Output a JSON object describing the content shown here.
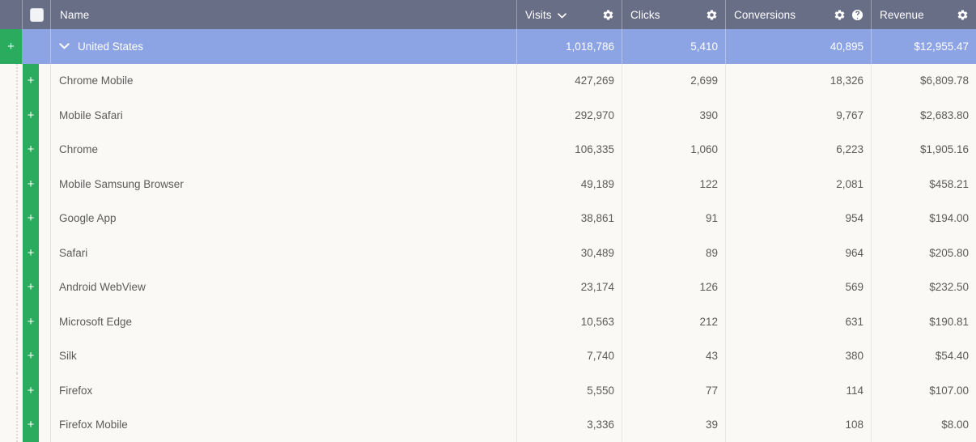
{
  "colors": {
    "header_bg": "#676e86",
    "selected_row_bg": "#8ca3e4",
    "row_bg": "#faf9f5",
    "expander_green": "#2bab5d",
    "text": "#5b5b5b",
    "header_text": "#ffffff"
  },
  "header": {
    "select_all_checkbox": "unchecked",
    "columns": [
      {
        "label": "Name",
        "key": "name",
        "sorted": false,
        "has_gear": false,
        "has_help": false,
        "align": "left"
      },
      {
        "label": "Visits",
        "key": "visits",
        "sorted": true,
        "has_gear": true,
        "has_help": false,
        "align": "right"
      },
      {
        "label": "Clicks",
        "key": "clicks",
        "sorted": false,
        "has_gear": true,
        "has_help": false,
        "align": "right"
      },
      {
        "label": "Conversions",
        "key": "conversions",
        "sorted": false,
        "has_gear": true,
        "has_help": true,
        "align": "right"
      },
      {
        "label": "Revenue",
        "key": "revenue",
        "sorted": false,
        "has_gear": true,
        "has_help": false,
        "align": "right"
      }
    ],
    "icons": {
      "sort_chevron": "chevron-down-icon",
      "gear": "gear-icon",
      "help": "help-circle-icon"
    }
  },
  "rows": [
    {
      "name": "United States",
      "visits": "1,018,786",
      "clicks": "5,410",
      "conversions": "40,895",
      "revenue": "$12,955.47",
      "level": 0,
      "selected": true,
      "expanded": true
    },
    {
      "name": "Chrome Mobile",
      "visits": "427,269",
      "clicks": "2,699",
      "conversions": "18,326",
      "revenue": "$6,809.78",
      "level": 1,
      "selected": false,
      "expanded": false
    },
    {
      "name": "Mobile Safari",
      "visits": "292,970",
      "clicks": "390",
      "conversions": "9,767",
      "revenue": "$2,683.80",
      "level": 1,
      "selected": false,
      "expanded": false
    },
    {
      "name": "Chrome",
      "visits": "106,335",
      "clicks": "1,060",
      "conversions": "6,223",
      "revenue": "$1,905.16",
      "level": 1,
      "selected": false,
      "expanded": false
    },
    {
      "name": "Mobile Samsung Browser",
      "visits": "49,189",
      "clicks": "122",
      "conversions": "2,081",
      "revenue": "$458.21",
      "level": 1,
      "selected": false,
      "expanded": false
    },
    {
      "name": "Google App",
      "visits": "38,861",
      "clicks": "91",
      "conversions": "954",
      "revenue": "$194.00",
      "level": 1,
      "selected": false,
      "expanded": false
    },
    {
      "name": "Safari",
      "visits": "30,489",
      "clicks": "89",
      "conversions": "964",
      "revenue": "$205.80",
      "level": 1,
      "selected": false,
      "expanded": false
    },
    {
      "name": "Android WebView",
      "visits": "23,174",
      "clicks": "126",
      "conversions": "569",
      "revenue": "$232.50",
      "level": 1,
      "selected": false,
      "expanded": false
    },
    {
      "name": "Microsoft Edge",
      "visits": "10,563",
      "clicks": "212",
      "conversions": "631",
      "revenue": "$190.81",
      "level": 1,
      "selected": false,
      "expanded": false
    },
    {
      "name": "Silk",
      "visits": "7,740",
      "clicks": "43",
      "conversions": "380",
      "revenue": "$54.40",
      "level": 1,
      "selected": false,
      "expanded": false
    },
    {
      "name": "Firefox",
      "visits": "5,550",
      "clicks": "77",
      "conversions": "114",
      "revenue": "$107.00",
      "level": 1,
      "selected": false,
      "expanded": false
    },
    {
      "name": "Firefox Mobile",
      "visits": "3,336",
      "clicks": "39",
      "conversions": "108",
      "revenue": "$8.00",
      "level": 1,
      "selected": false,
      "expanded": false
    }
  ],
  "expander_label": "+"
}
